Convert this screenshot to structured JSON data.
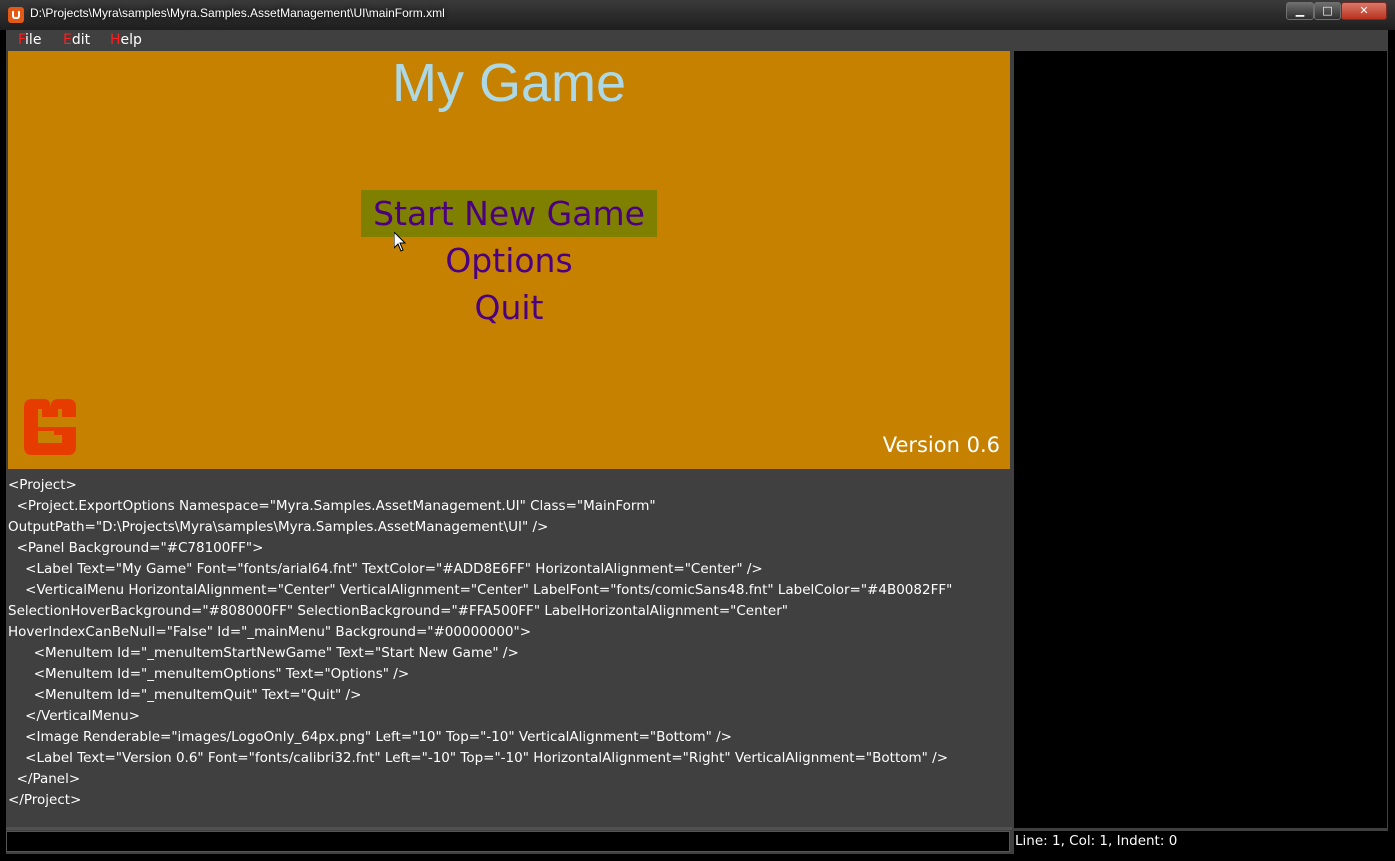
{
  "window": {
    "title": "D:\\Projects\\Myra\\samples\\Myra.Samples.AssetManagement\\UI\\mainForm.xml",
    "minimize_label": "▁",
    "maximize_label": "□",
    "close_label": "✕"
  },
  "menubar": {
    "file": {
      "hotkey": "F",
      "rest": "ile"
    },
    "edit": {
      "hotkey": "E",
      "rest": "dit"
    },
    "help": {
      "hotkey": "H",
      "rest": "elp"
    }
  },
  "preview": {
    "background": "#C78100",
    "title": "My Game",
    "title_color": "#ADD8E6",
    "menu_items": [
      "Start New Game",
      "Options",
      "Quit"
    ],
    "menu_label_color": "#4B0082",
    "hover_background": "#808000",
    "hovered_index": 0,
    "version": "Version 0.6",
    "logo_icon": "monogame-logo-icon"
  },
  "editor": {
    "lines": [
      "<Project>",
      "  <Project.ExportOptions Namespace=\"Myra.Samples.AssetManagement.UI\" Class=\"MainForm\"",
      "OutputPath=\"D:\\Projects\\Myra\\samples\\Myra.Samples.AssetManagement\\UI\" />",
      "  <Panel Background=\"#C78100FF\">",
      "    <Label Text=\"My Game\" Font=\"fonts/arial64.fnt\" TextColor=\"#ADD8E6FF\" HorizontalAlignment=\"Center\" />",
      "    <VerticalMenu HorizontalAlignment=\"Center\" VerticalAlignment=\"Center\" LabelFont=\"fonts/comicSans48.fnt\" LabelColor=\"#4B0082FF\"",
      "SelectionHoverBackground=\"#808000FF\" SelectionBackground=\"#FFA500FF\" LabelHorizontalAlignment=\"Center\"",
      "HoverIndexCanBeNull=\"False\" Id=\"_mainMenu\" Background=\"#00000000\">",
      "      <MenuItem Id=\"_menuItemStartNewGame\" Text=\"Start New Game\" />",
      "      <MenuItem Id=\"_menuItemOptions\" Text=\"Options\" />",
      "      <MenuItem Id=\"_menuItemQuit\" Text=\"Quit\" />",
      "    </VerticalMenu>",
      "    <Image Renderable=\"images/LogoOnly_64px.png\" Left=\"10\" Top=\"-10\" VerticalAlignment=\"Bottom\" />",
      "    <Label Text=\"Version 0.6\" Font=\"fonts/calibri32.fnt\" Left=\"-10\" Top=\"-10\" HorizontalAlignment=\"Right\" VerticalAlignment=\"Bottom\" />",
      "  </Panel>",
      "</Project>"
    ]
  },
  "status": {
    "text": "Line: 1, Col: 1, Indent: 0"
  }
}
